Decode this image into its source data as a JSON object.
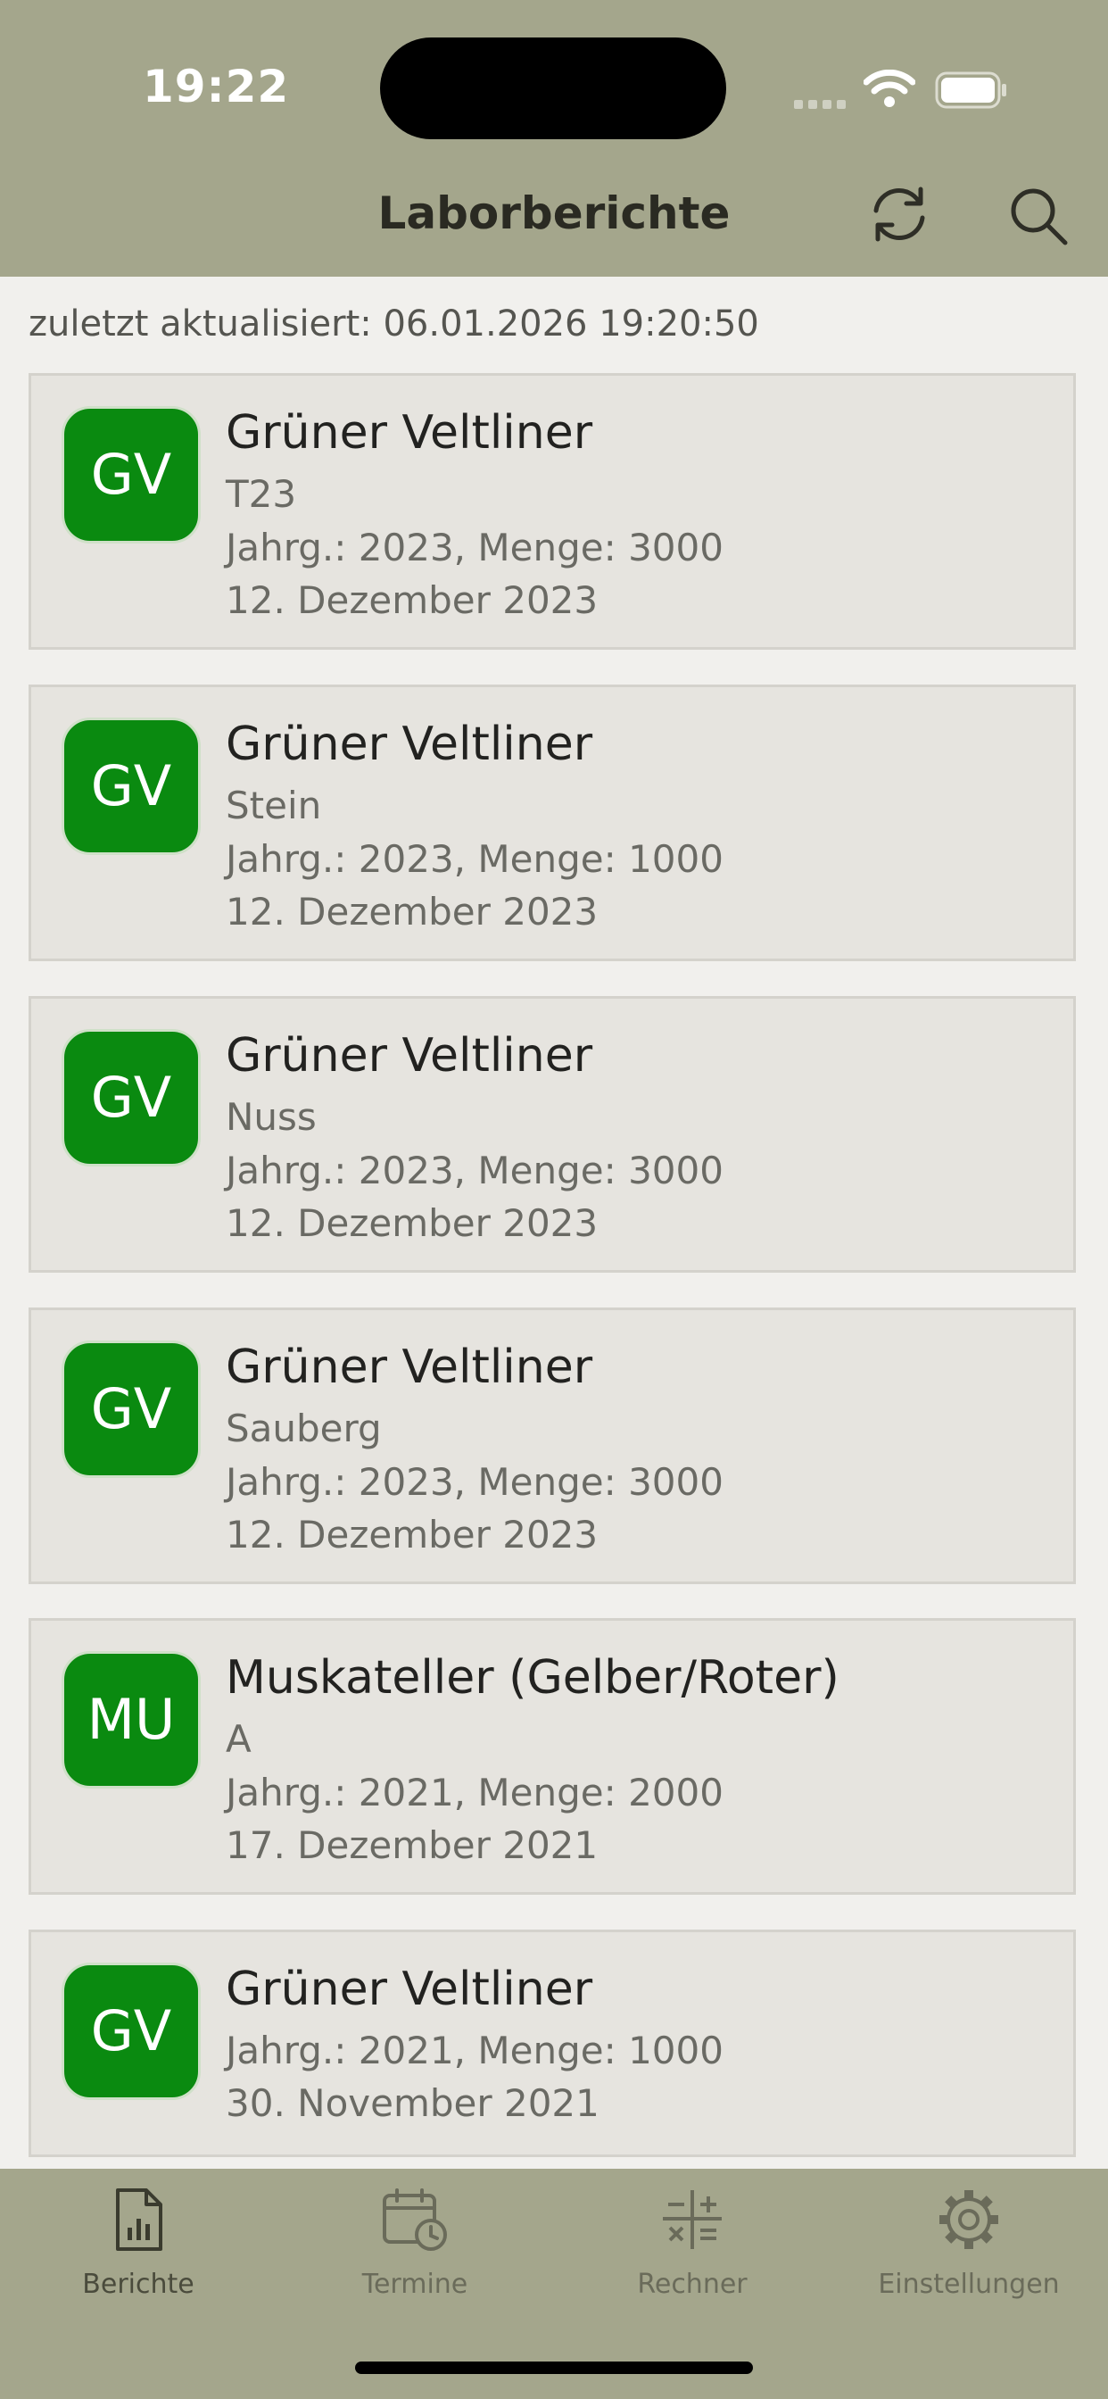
{
  "status_bar": {
    "time": "19:22"
  },
  "header": {
    "title": "Laborberichte"
  },
  "updated_text": "zuletzt aktualisiert: 06.01.2026 19:20:50",
  "reports": [
    {
      "badge": "GV",
      "name": "Grüner Veltliner",
      "sub": "T23",
      "meta": "Jahrg.: 2023, Menge: 3000",
      "date": "12. Dezember 2023"
    },
    {
      "badge": "GV",
      "name": "Grüner Veltliner",
      "sub": "Stein",
      "meta": "Jahrg.: 2023, Menge: 1000",
      "date": "12. Dezember 2023"
    },
    {
      "badge": "GV",
      "name": "Grüner Veltliner",
      "sub": "Nuss",
      "meta": "Jahrg.: 2023, Menge: 3000",
      "date": "12. Dezember 2023"
    },
    {
      "badge": "GV",
      "name": "Grüner Veltliner",
      "sub": "Sauberg",
      "meta": "Jahrg.: 2023, Menge: 3000",
      "date": "12. Dezember 2023"
    },
    {
      "badge": "MU",
      "name": "Muskateller (Gelber/Roter)",
      "sub": "A",
      "meta": "Jahrg.: 2021, Menge: 2000",
      "date": "17. Dezember 2021"
    },
    {
      "badge": "GV",
      "name": "Grüner Veltliner",
      "meta": "Jahrg.: 2021, Menge: 1000",
      "date": "30. November 2021"
    }
  ],
  "tabs": [
    {
      "label": "Berichte",
      "icon": "report-icon"
    },
    {
      "label": "Termine",
      "icon": "calendar-clock-icon"
    },
    {
      "label": "Rechner",
      "icon": "calculator-icon"
    },
    {
      "label": "Einstellungen",
      "icon": "gear-icon"
    }
  ],
  "colors": {
    "header_bg": "#a4a68c",
    "badge_green": "#0a8a10",
    "card_bg": "#e6e4df",
    "page_bg": "#f1f0ed"
  }
}
